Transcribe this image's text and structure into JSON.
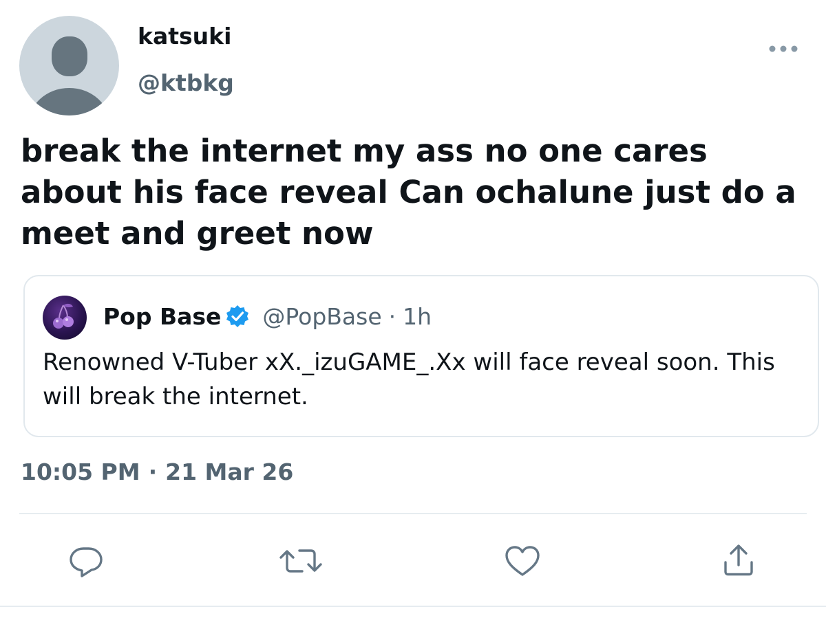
{
  "author": {
    "display_name": "katsuki",
    "handle": "@ktbkg",
    "avatar_icon": "default-avatar-icon"
  },
  "tweet": {
    "text": "break the internet my ass no one cares about his face reveal Can ochalune just do a meet and greet now",
    "time": "10:05 PM",
    "separator": "·",
    "date": "21 Mar 26"
  },
  "quoted_tweet": {
    "display_name": "Pop Base",
    "verified": true,
    "handle": "@PopBase",
    "separator": "·",
    "time": "1h",
    "text": "Renowned V-Tuber xX._izuGAME_.Xx will face reveal soon. This will break the internet.",
    "avatar_icon": "cherry-logo-icon"
  },
  "actions": [
    {
      "name": "reply",
      "icon": "reply-icon"
    },
    {
      "name": "retweet",
      "icon": "retweet-icon"
    },
    {
      "name": "like",
      "icon": "heart-icon"
    },
    {
      "name": "share",
      "icon": "share-icon"
    }
  ],
  "colors": {
    "text_primary": "#0f1419",
    "text_secondary": "#536471",
    "verified_blue": "#1d9bf0",
    "border": "#e1e8ed",
    "avatar_bg": "#ccd6dd",
    "avatar_fg": "#66757f"
  }
}
